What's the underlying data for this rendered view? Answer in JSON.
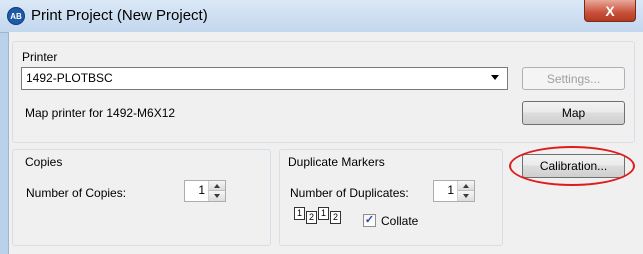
{
  "window": {
    "title": "Print Project (New Project)",
    "logo_text": "AB",
    "close_glyph": "X"
  },
  "printer_group": {
    "label": "Printer",
    "selected_printer": "1492-PLOTBSC",
    "settings_label": "Settings...",
    "map_text": "Map printer for 1492-M6X12",
    "map_label": "Map",
    "calibration_label": "Calibration..."
  },
  "copies_group": {
    "label": "Copies",
    "number_label": "Number of Copies:",
    "number_value": "1"
  },
  "duplicates_group": {
    "label": "Duplicate Markers",
    "number_label": "Number of Duplicates:",
    "number_value": "1",
    "collate_pages": [
      "1",
      "2",
      "1",
      "2"
    ],
    "collate_label": "Collate",
    "collate_checked": true
  },
  "colors": {
    "highlight_ellipse": "#e01b1b",
    "title_bar": "#c3d7ee",
    "close_button": "#c9503a"
  }
}
